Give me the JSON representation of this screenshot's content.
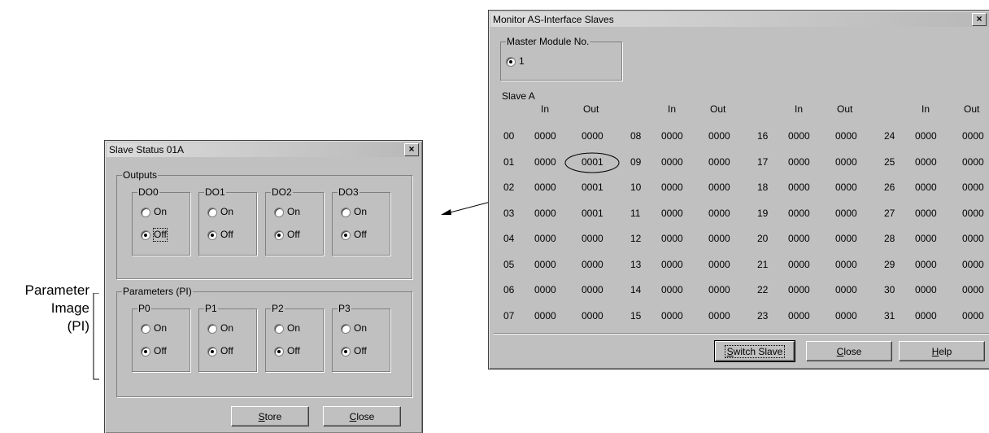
{
  "slave_status": {
    "title": "Slave Status  01A",
    "close_x": "×",
    "outputs_label": "Outputs",
    "outputs": [
      {
        "label": "DO0",
        "on": "On",
        "off": "Off",
        "selected": "off"
      },
      {
        "label": "DO1",
        "on": "On",
        "off": "Off",
        "selected": "off"
      },
      {
        "label": "DO2",
        "on": "On",
        "off": "Off",
        "selected": "off"
      },
      {
        "label": "DO3",
        "on": "On",
        "off": "Off",
        "selected": "off"
      }
    ],
    "params_label": "Parameters (PI)",
    "params": [
      {
        "label": "P0",
        "on": "On",
        "off": "Off",
        "selected": "off"
      },
      {
        "label": "P1",
        "on": "On",
        "off": "Off",
        "selected": "off"
      },
      {
        "label": "P2",
        "on": "On",
        "off": "Off",
        "selected": "off"
      },
      {
        "label": "P3",
        "on": "On",
        "off": "Off",
        "selected": "off"
      }
    ],
    "store_label": "Store",
    "close_label": "Close"
  },
  "annotation": {
    "line1": "Parameter",
    "line2": "Image",
    "line3": "(PI)"
  },
  "monitor": {
    "title": "Monitor AS-Interface Slaves",
    "close_x": "×",
    "master_group_label": "Master Module No.",
    "master_value": "1",
    "slave_label": "Slave A",
    "col_in": "In",
    "col_out": "Out",
    "columns": [
      {
        "rows": [
          [
            "00",
            "0000",
            "0000"
          ],
          [
            "01",
            "0000",
            "0001"
          ],
          [
            "02",
            "0000",
            "0001"
          ],
          [
            "03",
            "0000",
            "0001"
          ],
          [
            "04",
            "0000",
            "0000"
          ],
          [
            "05",
            "0000",
            "0000"
          ],
          [
            "06",
            "0000",
            "0000"
          ],
          [
            "07",
            "0000",
            "0000"
          ]
        ]
      },
      {
        "rows": [
          [
            "08",
            "0000",
            "0000"
          ],
          [
            "09",
            "0000",
            "0000"
          ],
          [
            "10",
            "0000",
            "0000"
          ],
          [
            "11",
            "0000",
            "0000"
          ],
          [
            "12",
            "0000",
            "0000"
          ],
          [
            "13",
            "0000",
            "0000"
          ],
          [
            "14",
            "0000",
            "0000"
          ],
          [
            "15",
            "0000",
            "0000"
          ]
        ]
      },
      {
        "rows": [
          [
            "16",
            "0000",
            "0000"
          ],
          [
            "17",
            "0000",
            "0000"
          ],
          [
            "18",
            "0000",
            "0000"
          ],
          [
            "19",
            "0000",
            "0000"
          ],
          [
            "20",
            "0000",
            "0000"
          ],
          [
            "21",
            "0000",
            "0000"
          ],
          [
            "22",
            "0000",
            "0000"
          ],
          [
            "23",
            "0000",
            "0000"
          ]
        ]
      },
      {
        "rows": [
          [
            "24",
            "0000",
            "0000"
          ],
          [
            "25",
            "0000",
            "0000"
          ],
          [
            "26",
            "0000",
            "0000"
          ],
          [
            "27",
            "0000",
            "0000"
          ],
          [
            "28",
            "0000",
            "0000"
          ],
          [
            "29",
            "0000",
            "0000"
          ],
          [
            "30",
            "0000",
            "0000"
          ],
          [
            "31",
            "0000",
            "0000"
          ]
        ]
      }
    ],
    "switch_slave_label": "Switch Slave",
    "close_label": "Close",
    "help_label": "Help"
  }
}
